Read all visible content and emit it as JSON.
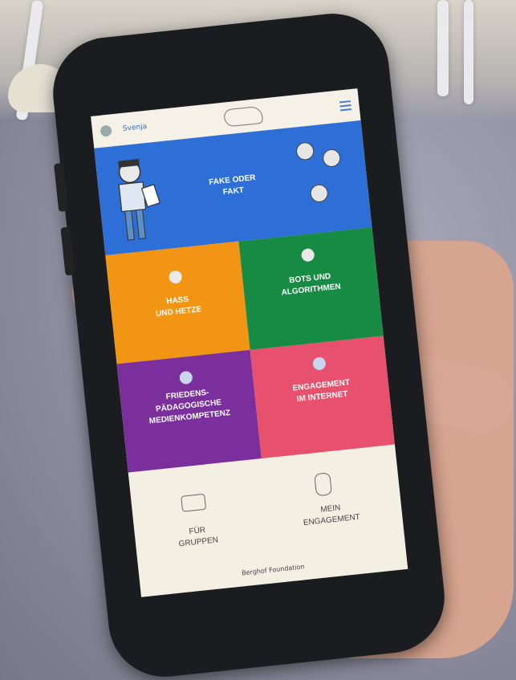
{
  "app": {
    "username": "Svenja",
    "tiles": [
      {
        "label_1": "FAKE ODER",
        "label_2": "FAKT",
        "color": "#2d6fd6"
      },
      {
        "label_1": "HASS",
        "label_2": "UND HETZE",
        "color": "#f29414"
      },
      {
        "label_1": "BOTS UND",
        "label_2": "ALGORITHMEN",
        "color": "#178a43"
      },
      {
        "label_1": "FRIEDENS-",
        "label_2": "PÄDAGOGISCHE",
        "label_3": "MEDIENKOMPETENZ",
        "color": "#7a2f9d"
      },
      {
        "label_1": "ENGAGEMENT",
        "label_2": "IM INTERNET",
        "color": "#e8516d"
      }
    ],
    "bottom": {
      "left_1": "FÜR",
      "left_2": "GRUPPEN",
      "right_1": "MEIN",
      "right_2": "ENGAGEMENT"
    },
    "footer": "Berghof Foundation"
  },
  "icons": {
    "menu": "hamburger-menu-icon",
    "avatar": "avatar-icon",
    "logo": "app-logo"
  }
}
